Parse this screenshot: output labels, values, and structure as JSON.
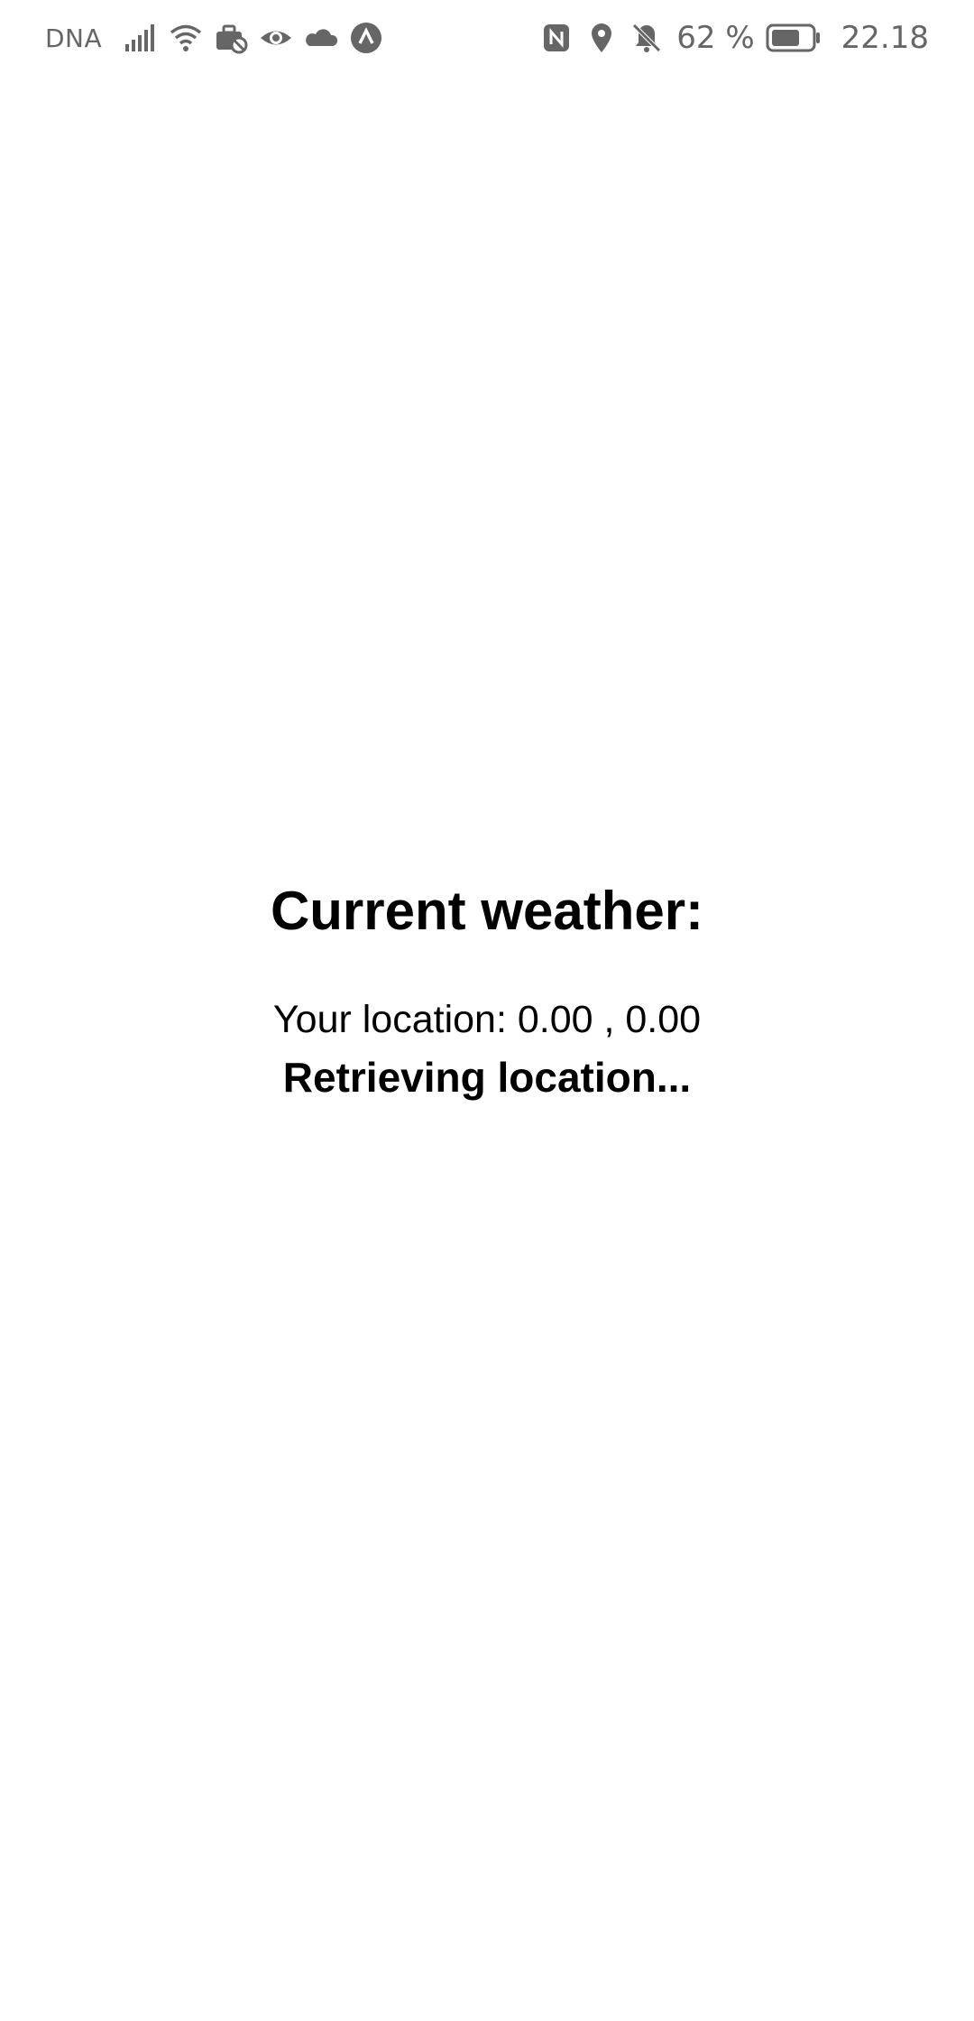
{
  "status_bar": {
    "carrier": "DNA",
    "battery_percent": "62 %",
    "time": "22.18",
    "icons": [
      "signal-icon",
      "wifi-icon",
      "work-profile-icon",
      "eye-icon",
      "cloud-icon",
      "app-notification-icon",
      "nfc-icon",
      "location-icon",
      "bell-muted-icon",
      "battery-icon"
    ]
  },
  "main": {
    "title": "Current weather:",
    "location_text": "Your location: 0.00 , 0.00",
    "status_text": "Retrieving location..."
  },
  "colors": {
    "background": "#ffffff",
    "text": "#000000",
    "status_bar_text": "#666666"
  }
}
